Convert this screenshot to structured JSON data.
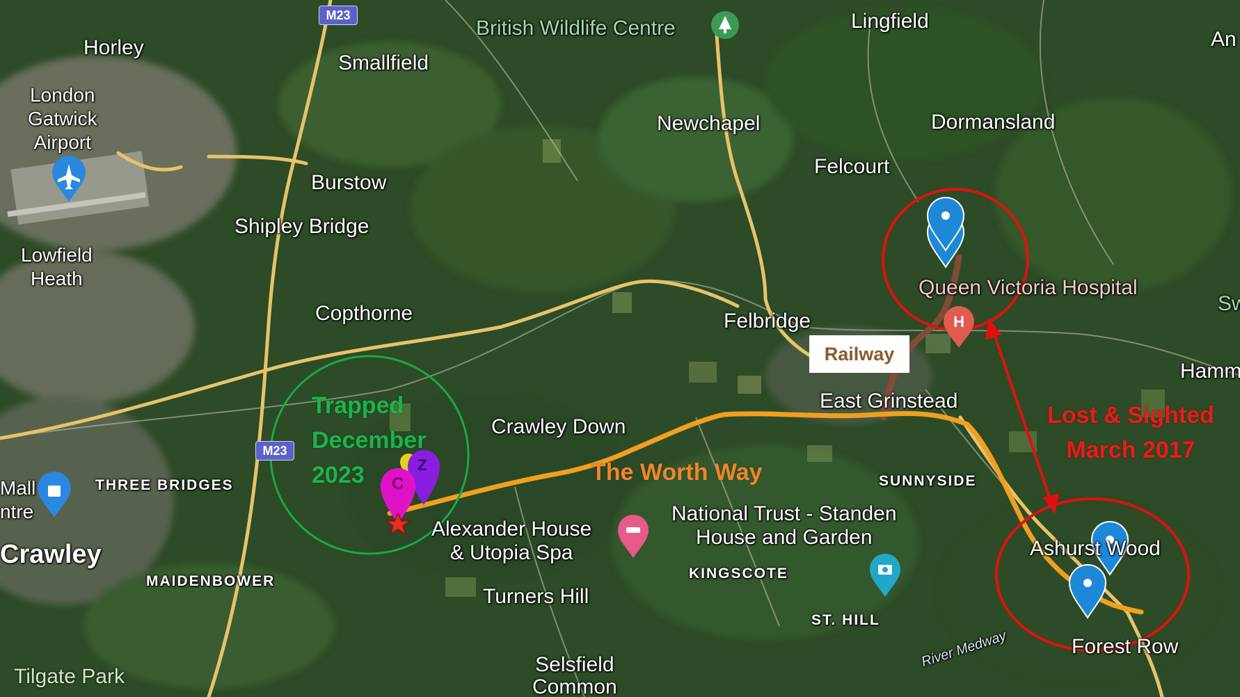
{
  "roads": {
    "m23_shield": "M23"
  },
  "places": {
    "horley": "Horley",
    "gatwick": "London\nGatwick\nAirport",
    "lowfield_heath": "Lowfield\nHeath",
    "smallfield": "Smallfield",
    "burstow": "Burstow",
    "shipley_bridge": "Shipley Bridge",
    "copthorne": "Copthorne",
    "three_bridges": "THREE BRIDGES",
    "mall_centre": "Mall\nntre",
    "crawley": "Crawley",
    "maidenbower": "MAIDENBOWER",
    "tilgate_park": "Tilgate Park",
    "british_wildlife_centre": "British Wildlife Centre",
    "lingfield": "Lingfield",
    "an": "An",
    "newchapel": "Newchapel",
    "dormansland": "Dormansland",
    "felcourt": "Felcourt",
    "queen_victoria_hospital": "Queen Victoria Hospital",
    "sw": "Sw",
    "felbridge": "Felbridge",
    "east_grinstead": "East Grinstead",
    "hamm": "Hamm",
    "crawley_down": "Crawley Down",
    "sunnyside": "SUNNYSIDE",
    "national_trust": "National Trust - Standen\nHouse and Garden",
    "alexander_house": "Alexander House\n& Utopia Spa",
    "kingscote": "KINGSCOTE",
    "turners_hill": "Turners Hill",
    "st_hill": "ST. HILL",
    "ashurst_wood": "Ashurst Wood",
    "forest_row": "Forest Row",
    "river_medway": "River Medway",
    "selsfield_common": "Selsfield\nCommon"
  },
  "annotations": {
    "trapped": "Trapped\nDecember\n2023",
    "lost_sighted": "Lost & Sighted\nMarch 2017",
    "worth_way": "The Worth Way",
    "railway": "Railway"
  },
  "markers": {
    "c_letter": "C",
    "z_letter": "Z"
  },
  "colors": {
    "worth_way": "#f0a020",
    "railway": "#8b4a3a",
    "circle_red": "#e01010",
    "circle_green": "#1aa84a",
    "pin_blue": "#1e88d8",
    "pin_magenta": "#e012c8",
    "pin_purple": "#8a1ee0",
    "star_red": "#e03020"
  }
}
